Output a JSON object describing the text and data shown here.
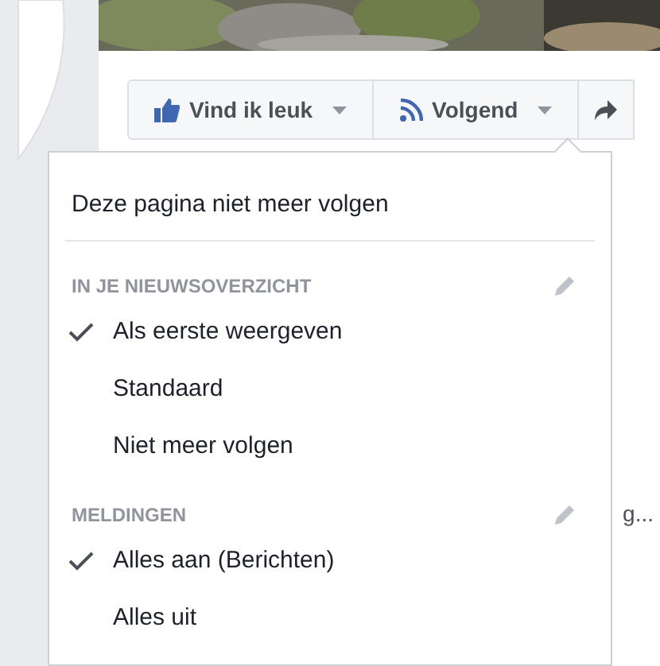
{
  "page_actions": [
    {
      "label": "Vind ik leuk",
      "kind": "thumb"
    },
    {
      "label": "Volgend",
      "kind": "rss"
    }
  ],
  "background_text": "g...",
  "dropdown": {
    "top_item": "Deze pagina niet meer volgen",
    "sections": [
      {
        "header": "IN JE NIEUWSOVERZICHT",
        "items": [
          {
            "label": "Als eerste weergeven",
            "selected": true
          },
          {
            "label": "Standaard",
            "selected": false
          },
          {
            "label": "Niet meer volgen",
            "selected": false
          }
        ]
      },
      {
        "header": "MELDINGEN",
        "items": [
          {
            "label": "Alles aan (Berichten)",
            "selected": true
          },
          {
            "label": "Alles uit",
            "selected": false
          }
        ]
      }
    ]
  }
}
